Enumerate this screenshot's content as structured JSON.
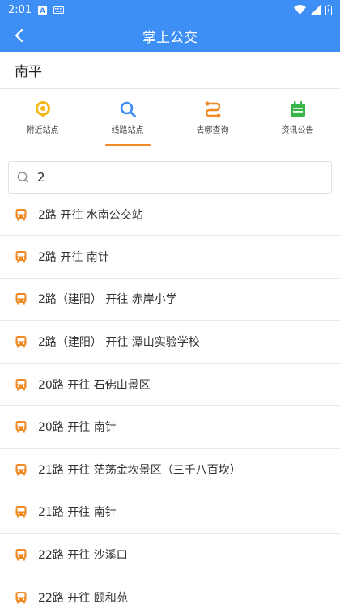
{
  "status": {
    "time": "2:01"
  },
  "header": {
    "title": "掌上公交"
  },
  "city": {
    "name": "南平"
  },
  "tabs": [
    {
      "label": "附近站点",
      "icon": "location-pin-icon"
    },
    {
      "label": "线路站点",
      "icon": "search-icon",
      "active": true
    },
    {
      "label": "去哪查询",
      "icon": "route-icon"
    },
    {
      "label": "资讯公告",
      "icon": "calendar-icon"
    }
  ],
  "search": {
    "value": "2",
    "placeholder": ""
  },
  "routes": [
    "2路 开往 水南公交站",
    "2路 开往 南针",
    "2路（建阳） 开往 赤岸小学",
    "2路（建阳） 开往 潭山实验学校",
    "20路 开往 石佛山景区",
    "20路 开往 南针",
    "21路 开往 茫荡金坎景区（三千八百坎）",
    "21路 开往 南针",
    "22路 开往 沙溪口",
    "22路 开往 颐和苑"
  ],
  "colors": {
    "primary": "#3d8ef5",
    "accent": "#f08a24",
    "green": "#39b54a"
  }
}
